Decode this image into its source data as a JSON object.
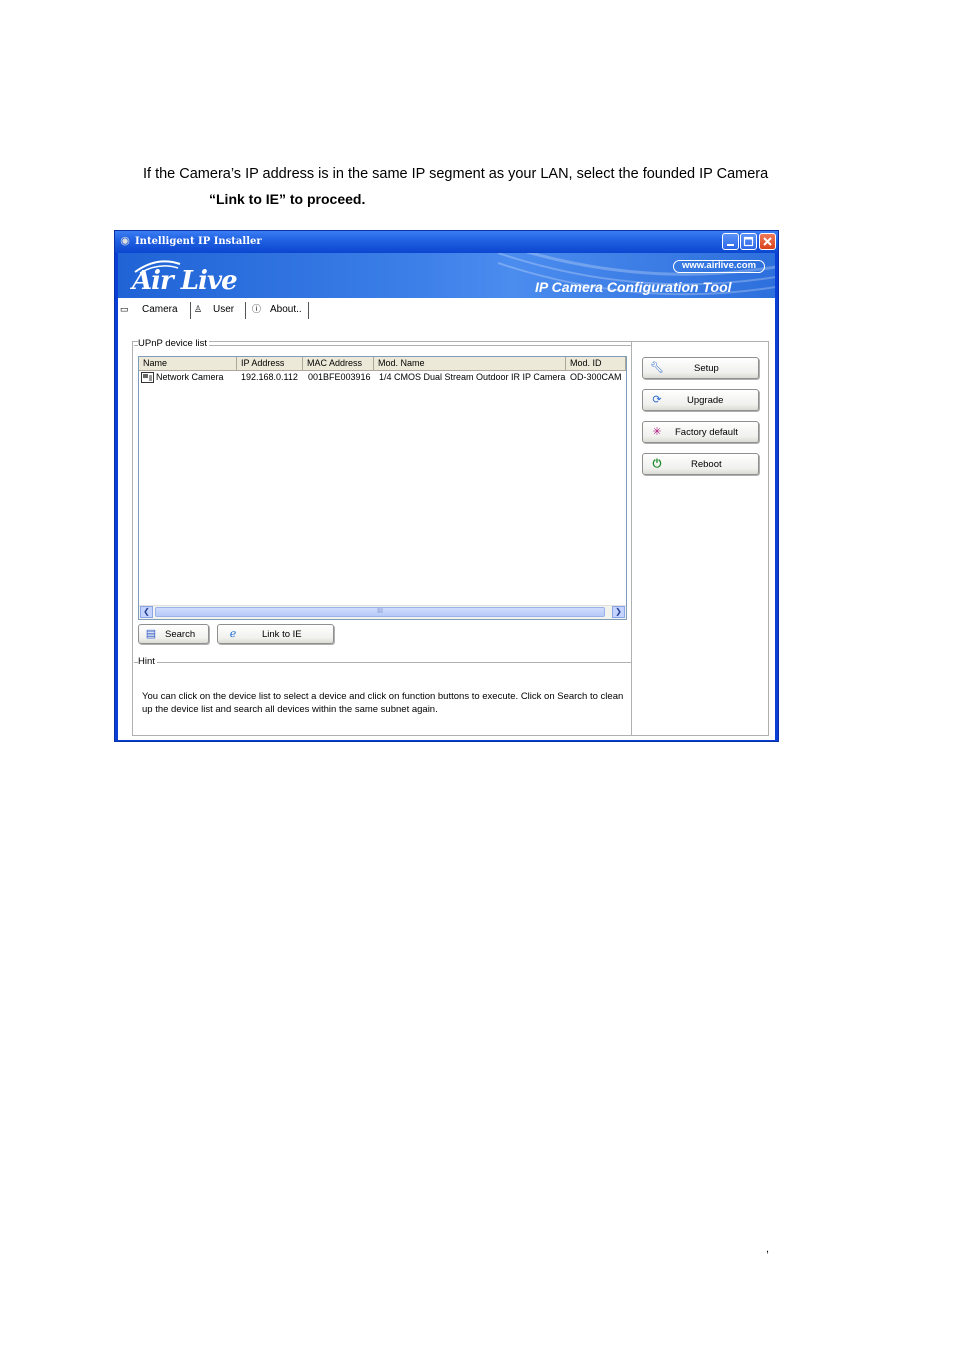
{
  "document": {
    "line1": "If the Camera’s IP address is in the same IP segment as your LAN, select the founded IP Camera",
    "line2": "“Link to IE” to proceed.",
    "page_mark": ","
  },
  "window": {
    "title": "Intelligent IP Installer",
    "banner": {
      "logo": "Air Live",
      "url": "www.airlive.com",
      "tool_title": "IP Camera Configuration Tool"
    },
    "tabs": [
      {
        "label": "Camera",
        "icon": "camera-icon"
      },
      {
        "label": "User",
        "icon": "user-icon"
      },
      {
        "label": "About..",
        "icon": "info-icon"
      }
    ],
    "device_list": {
      "group_label": "UPnP device list",
      "columns": [
        "Name",
        "IP Address",
        "MAC Address",
        "Mod. Name",
        "Mod. ID"
      ],
      "rows": [
        [
          "Network Camera",
          "192.168.0.112",
          "001BFE003916",
          "1/4 CMOS Dual Stream Outdoor IR IP Camera",
          "OD-300CAM"
        ]
      ],
      "scroll_thumb": "III"
    },
    "buttons": {
      "search": "Search",
      "link_to_ie": "Link to IE",
      "setup": "Setup",
      "upgrade": "Upgrade",
      "factory_default": "Factory default",
      "reboot": "Reboot"
    },
    "hint": {
      "group_label": "Hint",
      "text": "You can click on the device list to select a device and click on function buttons to execute. Click on Search to clean up the device list and search all devices  within the same subnet again."
    }
  },
  "colors": {
    "titlebar": "#1f5fe0",
    "banner": "#3c7fe8",
    "close_button": "#d8421b"
  }
}
